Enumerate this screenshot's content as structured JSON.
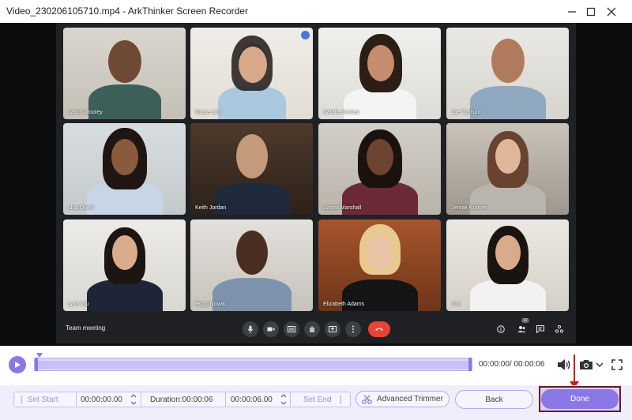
{
  "window": {
    "title": "Video_230206105710.mp4  -  ArkThinker Screen Recorder",
    "minimize_icon": "minimize-icon",
    "maximize_icon": "maximize-icon",
    "close_icon": "close-icon"
  },
  "meeting": {
    "label": "Team meeting",
    "participants": [
      {
        "name": "Jaxon Wooley"
      },
      {
        "name": "Grace Lim"
      },
      {
        "name": "Natalie Gomez"
      },
      {
        "name": "Joe Carlson"
      },
      {
        "name": "Lisa Oneill"
      },
      {
        "name": "Keith Jordan"
      },
      {
        "name": "Sasha Marshall"
      },
      {
        "name": "Jennie Kramer"
      },
      {
        "name": "Lara Wu"
      },
      {
        "name": "Hugo Novak"
      },
      {
        "name": "Elizabeth Adams"
      },
      {
        "name": "You"
      }
    ],
    "people_count": "12",
    "controls": [
      "mic-icon",
      "camera-icon",
      "captions-icon",
      "raise-hand-icon",
      "present-icon",
      "more-icon",
      "end-call-icon"
    ],
    "right_controls": [
      "info-icon",
      "people-icon",
      "chat-icon",
      "activities-icon"
    ]
  },
  "timeline": {
    "play_icon": "play-icon",
    "time_display": "00:00:00/ 00:00:06",
    "volume_icon": "volume-icon",
    "snapshot_icon": "camera-icon",
    "dropdown_icon": "chevron-down-icon",
    "fullscreen_icon": "fullscreen-icon",
    "progress": 0.0
  },
  "trim": {
    "set_start_label": "Set Start",
    "start_time": "00:00:00.00",
    "duration_label": "Duration:00:00:06",
    "end_time": "00:00:06.00",
    "set_end_label": "Set End",
    "advanced_trimmer_label": "Advanced Trimmer",
    "back_label": "Back",
    "done_label": "Done"
  },
  "colors": {
    "accent": "#8b78e6",
    "highlight_frame": "#6b1a2a",
    "arrow": "#d31a1a",
    "meet_bg": "#202124",
    "end_call": "#ea4335"
  }
}
